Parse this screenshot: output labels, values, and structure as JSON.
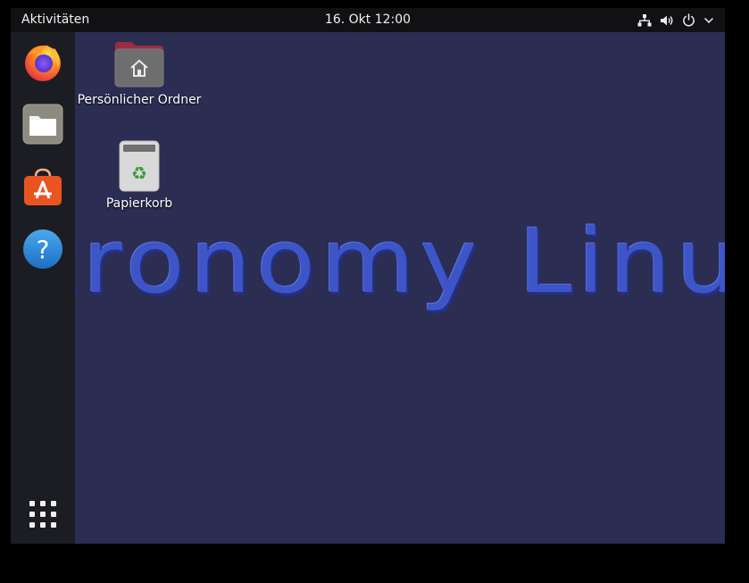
{
  "topbar": {
    "activities": "Aktivitäten",
    "clock": "16. Okt  12:00",
    "tray_icons": [
      "network-icon",
      "volume-icon",
      "power-icon",
      "chevron-down-icon"
    ]
  },
  "dock": {
    "items": [
      {
        "name": "Firefox",
        "icon": "firefox-icon"
      },
      {
        "name": "Dateien",
        "icon": "files-icon"
      },
      {
        "name": "Ubuntu Software",
        "icon": "software-store-icon"
      },
      {
        "name": "Hilfe",
        "icon": "help-icon"
      }
    ],
    "apps_grid_icon": "app-grid-icon"
  },
  "desktop": {
    "icons": [
      {
        "label": "Persönlicher Ordner",
        "icon": "home-folder-icon"
      },
      {
        "label": "Papierkorb",
        "icon": "trash-icon"
      }
    ]
  },
  "wallpaper": {
    "text": "stronomy Linu",
    "background_color": "#2b2d52",
    "text_color": "#3e55c7"
  },
  "colors": {
    "topbar": "#111114",
    "dock": "#1c1d22",
    "accent": "#e95420"
  }
}
